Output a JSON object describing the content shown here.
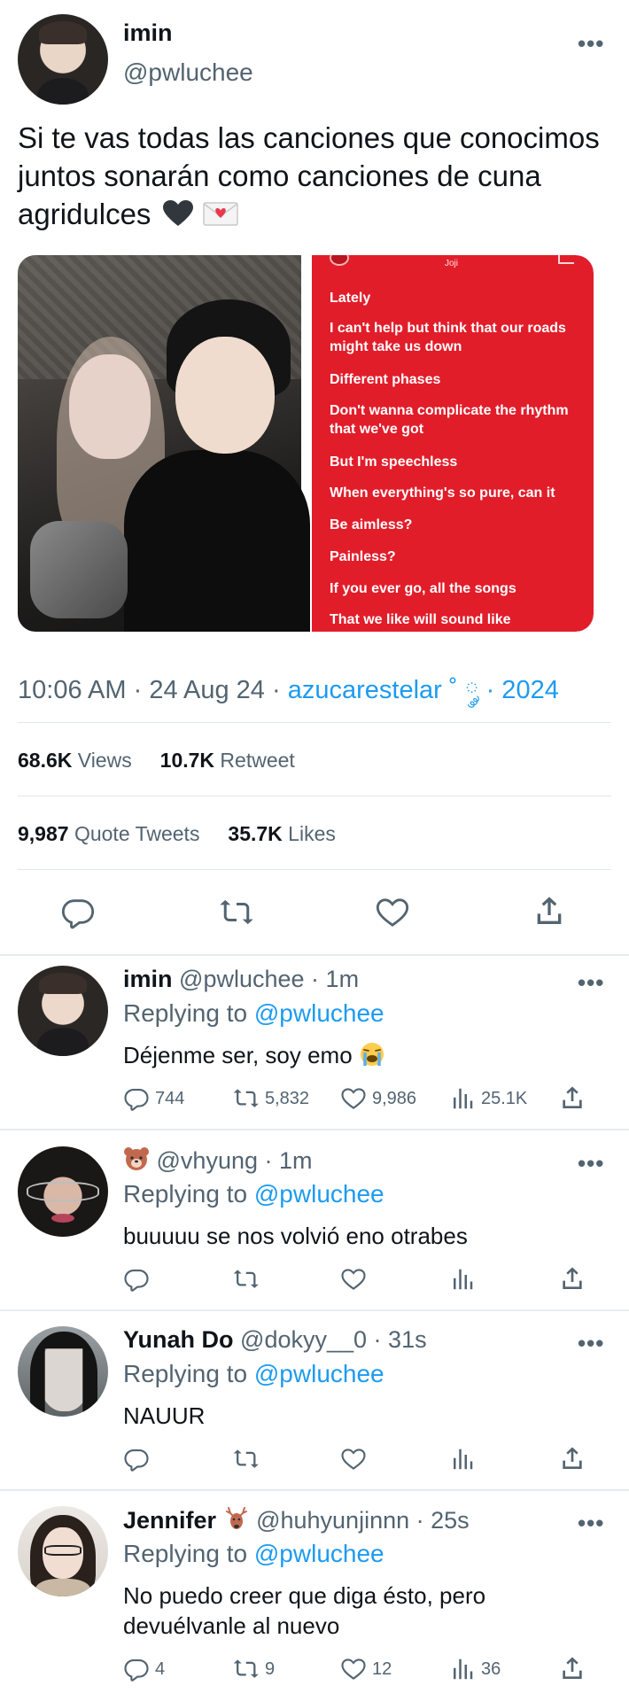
{
  "main_tweet": {
    "name": "imin",
    "handle": "@pwluchee",
    "more": "•••",
    "text": "Si te vas todas las canciones que conocimos juntos sonarán como canciones de cuna agridulces",
    "text_emojis": [
      "black-heart",
      "love-letter"
    ],
    "media": {
      "lyrics_card": {
        "artist": "Joji",
        "lines": [
          "Lately",
          "I can't help but think that our roads might take us down",
          "Different phases",
          "Don't wanna complicate the rhythm that we've got",
          "But I'm speechless",
          "When everything's so pure, can it",
          "Be aimless?",
          "Painless?",
          "If you ever go, all the songs",
          "That we like will sound like"
        ],
        "color": "#e21d2a"
      }
    },
    "time": "10:06 AM",
    "date": "24 Aug 24",
    "source": "azucarestelar ˚ ༘ · 2024",
    "views_count": "68.6K",
    "views_label": "Views",
    "retweet_count": "10.7K",
    "retweet_label": "Retweet",
    "quote_count": "9,987",
    "quote_label": "Quote Tweets",
    "likes_count": "35.7K",
    "likes_label": "Likes"
  },
  "replies": [
    {
      "name": "imin",
      "handle": "@pwluchee",
      "time": "1m",
      "replying_label": "Replying to",
      "replying_to": "@pwluchee",
      "text": "Déjenme ser, soy emo",
      "emoji": "loudly-crying-face",
      "reply_count": "744",
      "retweet_count": "5,832",
      "like_count": "9,986",
      "views_count": "25.1K"
    },
    {
      "name": "",
      "name_emoji": "bear-face",
      "handle": "@vhyung",
      "time": "1m",
      "replying_label": "Replying to",
      "replying_to": "@pwluchee",
      "text": "buuuuu se nos volvió eno otrabes",
      "reply_count": "",
      "retweet_count": "",
      "like_count": "",
      "views_count": ""
    },
    {
      "name": "Yunah Do",
      "handle": "@dokyy__0",
      "time": "31s",
      "replying_label": "Replying to",
      "replying_to": "@pwluchee",
      "text": "NAUUR",
      "reply_count": "",
      "retweet_count": "",
      "like_count": "",
      "views_count": ""
    },
    {
      "name": "Jennifer",
      "name_emoji": "deer",
      "handle": "@huhyunjinnn",
      "time": "25s",
      "replying_label": "Replying to",
      "replying_to": "@pwluchee",
      "text": "No puedo creer que diga ésto, pero devuélvanle al nuevo",
      "reply_count": "4",
      "retweet_count": "9",
      "like_count": "12",
      "views_count": "36"
    }
  ],
  "colors": {
    "link": "#1d9bf0",
    "secondary_text": "#536471",
    "primary_text": "#0f1419"
  }
}
